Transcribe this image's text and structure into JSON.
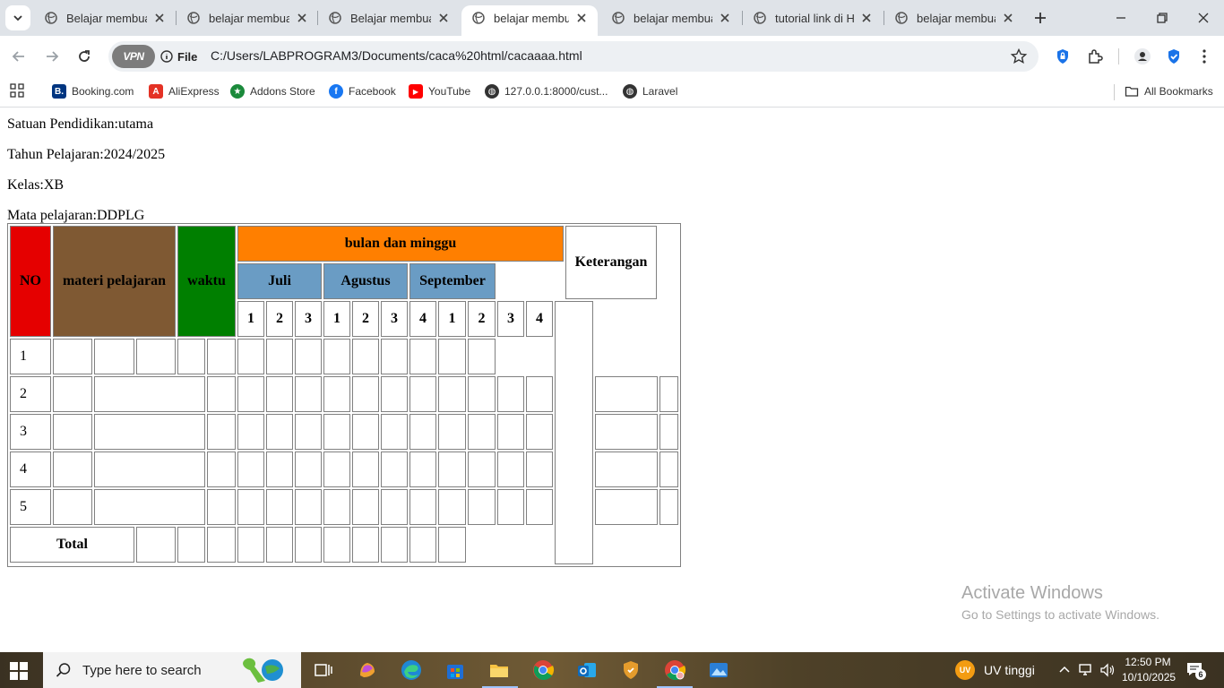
{
  "browser": {
    "tabs": [
      {
        "title": "Belajar membuat",
        "active": false
      },
      {
        "title": "belajar membuat",
        "active": false
      },
      {
        "title": "Belajar membuat",
        "active": false
      },
      {
        "title": "belajar membuat",
        "active": true
      },
      {
        "title": "belajar membuat",
        "active": false
      },
      {
        "title": "tutorial link di H",
        "active": false
      },
      {
        "title": "belajar membuat",
        "active": false
      }
    ],
    "vpn_label": "VPN",
    "scheme_label": "File",
    "url": "C:/Users/LABPROGRAM3/Documents/caca%20html/cacaaaa.html",
    "bookmarks": [
      {
        "label": "Booking.com",
        "icon": "booking-icon",
        "color": "#003580",
        "glyph": "B."
      },
      {
        "label": "AliExpress",
        "icon": "aliexpress-icon",
        "color": "#e43225",
        "glyph": "A"
      },
      {
        "label": "Addons Store",
        "icon": "addons-icon",
        "color": "#1b8a3b",
        "glyph": "★"
      },
      {
        "label": "Facebook",
        "icon": "facebook-icon",
        "color": "#1877f2",
        "glyph": "f"
      },
      {
        "label": "YouTube",
        "icon": "youtube-icon",
        "color": "#ff0000",
        "glyph": "▶"
      },
      {
        "label": "127.0.0.1:8000/cust...",
        "icon": "globe-icon",
        "color": "#333333",
        "glyph": "◍"
      },
      {
        "label": "Laravel",
        "icon": "globe-icon",
        "color": "#333333",
        "glyph": "◍"
      }
    ],
    "all_bookmarks": "All Bookmarks"
  },
  "page": {
    "info": [
      "Satuan Pendidikan:utama",
      "Tahun Pelajaran:2024/2025",
      "Kelas:XB",
      "Mata pelajaran:DDPLG"
    ],
    "table": {
      "header_no": "NO",
      "header_materi": "materi pelajaran",
      "header_waktu": "waktu",
      "header_bulan": "bulan dan minggu",
      "header_keterangan": "Keterangan",
      "months": [
        "Juli",
        "Agustus",
        "September"
      ],
      "weeks": [
        "1",
        "2",
        "3",
        "1",
        "2",
        "3",
        "4",
        "1",
        "2",
        "3",
        "4"
      ],
      "row_numbers": [
        "1",
        "2",
        "3",
        "4",
        "5"
      ],
      "total_label": "Total",
      "colors": {
        "no": "#e50000",
        "materi": "#7f5933",
        "waktu": "#007f00",
        "bulan": "#ff7f00",
        "month": "#6a9cc4"
      }
    },
    "watermark": {
      "title": "Activate Windows",
      "subtitle": "Go to Settings to activate Windows."
    }
  },
  "taskbar": {
    "search_placeholder": "Type here to search",
    "weather": "UV tinggi",
    "weather_badge": "UV",
    "time": "12:50 PM",
    "date": "10/10/2025",
    "notification_count": "6"
  }
}
